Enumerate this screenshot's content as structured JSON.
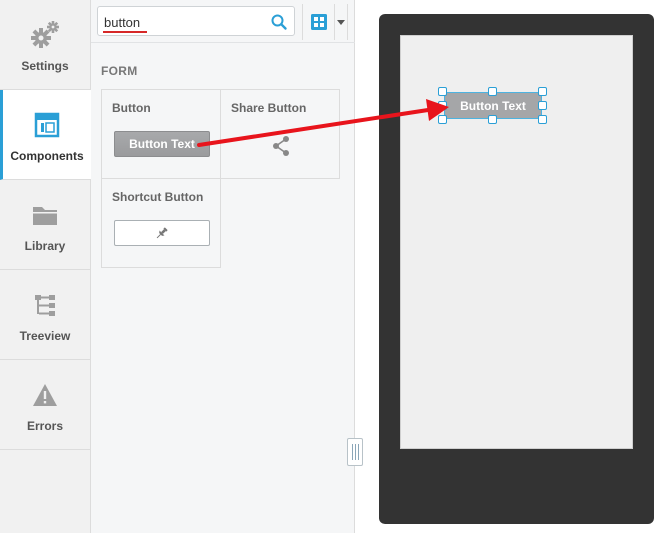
{
  "nav": {
    "items": [
      {
        "label": "Settings",
        "icon": "gears-icon",
        "active": false
      },
      {
        "label": "Components",
        "icon": "components-icon",
        "active": true
      },
      {
        "label": "Library",
        "icon": "folder-icon",
        "active": false
      },
      {
        "label": "Treeview",
        "icon": "treeview-icon",
        "active": false
      },
      {
        "label": "Errors",
        "icon": "warning-icon",
        "active": false
      }
    ]
  },
  "search": {
    "value": "button",
    "placeholder": ""
  },
  "panel": {
    "section_title": "FORM",
    "components": [
      {
        "title": "Button",
        "preview_label": "Button Text",
        "icon": ""
      },
      {
        "title": "Share Button",
        "preview_label": "",
        "icon": "share-icon"
      },
      {
        "title": "Shortcut Button",
        "preview_label": "",
        "icon": "pin-icon"
      }
    ]
  },
  "canvas": {
    "placed_button_label": "Button Text"
  },
  "colors": {
    "accent": "#2a9fd6",
    "arrow": "#e8141c",
    "device": "#333333",
    "button_gray": "#a5a6a8"
  }
}
